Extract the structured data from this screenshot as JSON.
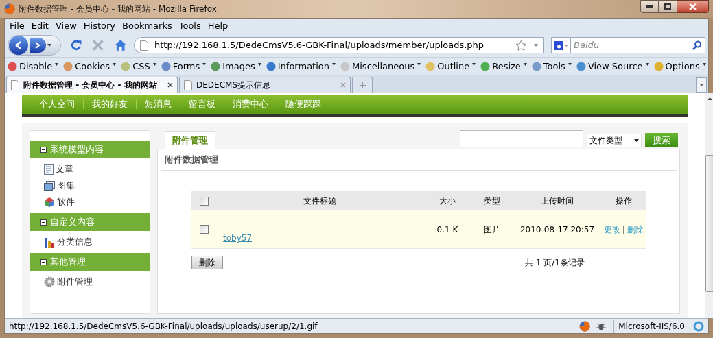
{
  "window": {
    "title": "附件数据管理 - 会员中心 - 我的网站 - Mozilla Firefox"
  },
  "menu": [
    "File",
    "Edit",
    "View",
    "History",
    "Bookmarks",
    "Tools",
    "Help"
  ],
  "address": {
    "value": "http://192.168.1.5/DedeCmsV5.6-GBK-Final/uploads/member/uploads.php"
  },
  "search_engine": {
    "placeholder": "Baidu"
  },
  "dev_toolbar": [
    "Disable",
    "Cookies",
    "CSS",
    "Forms",
    "Images",
    "Information",
    "Miscellaneous",
    "Outline",
    "Resize",
    "Tools",
    "View Source",
    "Options"
  ],
  "tabs": [
    {
      "label": "附件数据管理 - 会员中心 - 我的网站",
      "selected": true
    },
    {
      "label": "DEDECMS提示信息",
      "selected": false
    }
  ],
  "site_nav": [
    "个人空间",
    "我的好友",
    "短消息",
    "留言板",
    "消费中心",
    "随便踩踩"
  ],
  "sidebar": [
    {
      "title": "系统模型内容",
      "expanded": true,
      "items": [
        "文章",
        "图集",
        "软件"
      ]
    },
    {
      "title": "自定义内容",
      "expanded": true,
      "items": [
        "分类信息"
      ]
    },
    {
      "title": "其他管理",
      "expanded": true,
      "items": [
        "附件管理"
      ]
    }
  ],
  "content_tab": {
    "label": "附件管理",
    "selected": true
  },
  "filter": {
    "select": "文件类型",
    "button": "搜索"
  },
  "section_title": "附件数据管理",
  "table": {
    "columns": [
      "文件标题",
      "大小",
      "类型",
      "上传时间",
      "操作"
    ],
    "header_checked": false,
    "rows": [
      {
        "checked": false,
        "title": "toby57",
        "size": "0.1 K",
        "type": "图片",
        "time": "2010-08-17 20:57",
        "actions": [
          "更改",
          "删除"
        ],
        "separator": "|"
      }
    ]
  },
  "delete_button": "删除",
  "pagination": "共 1 页/1条记录",
  "status_bar": {
    "url": "http://192.168.1.5/DedeCmsV5.6-GBK-Final/uploads/uploads/userup/2/1.gif",
    "server": "Microsoft-IIS/6.0"
  }
}
